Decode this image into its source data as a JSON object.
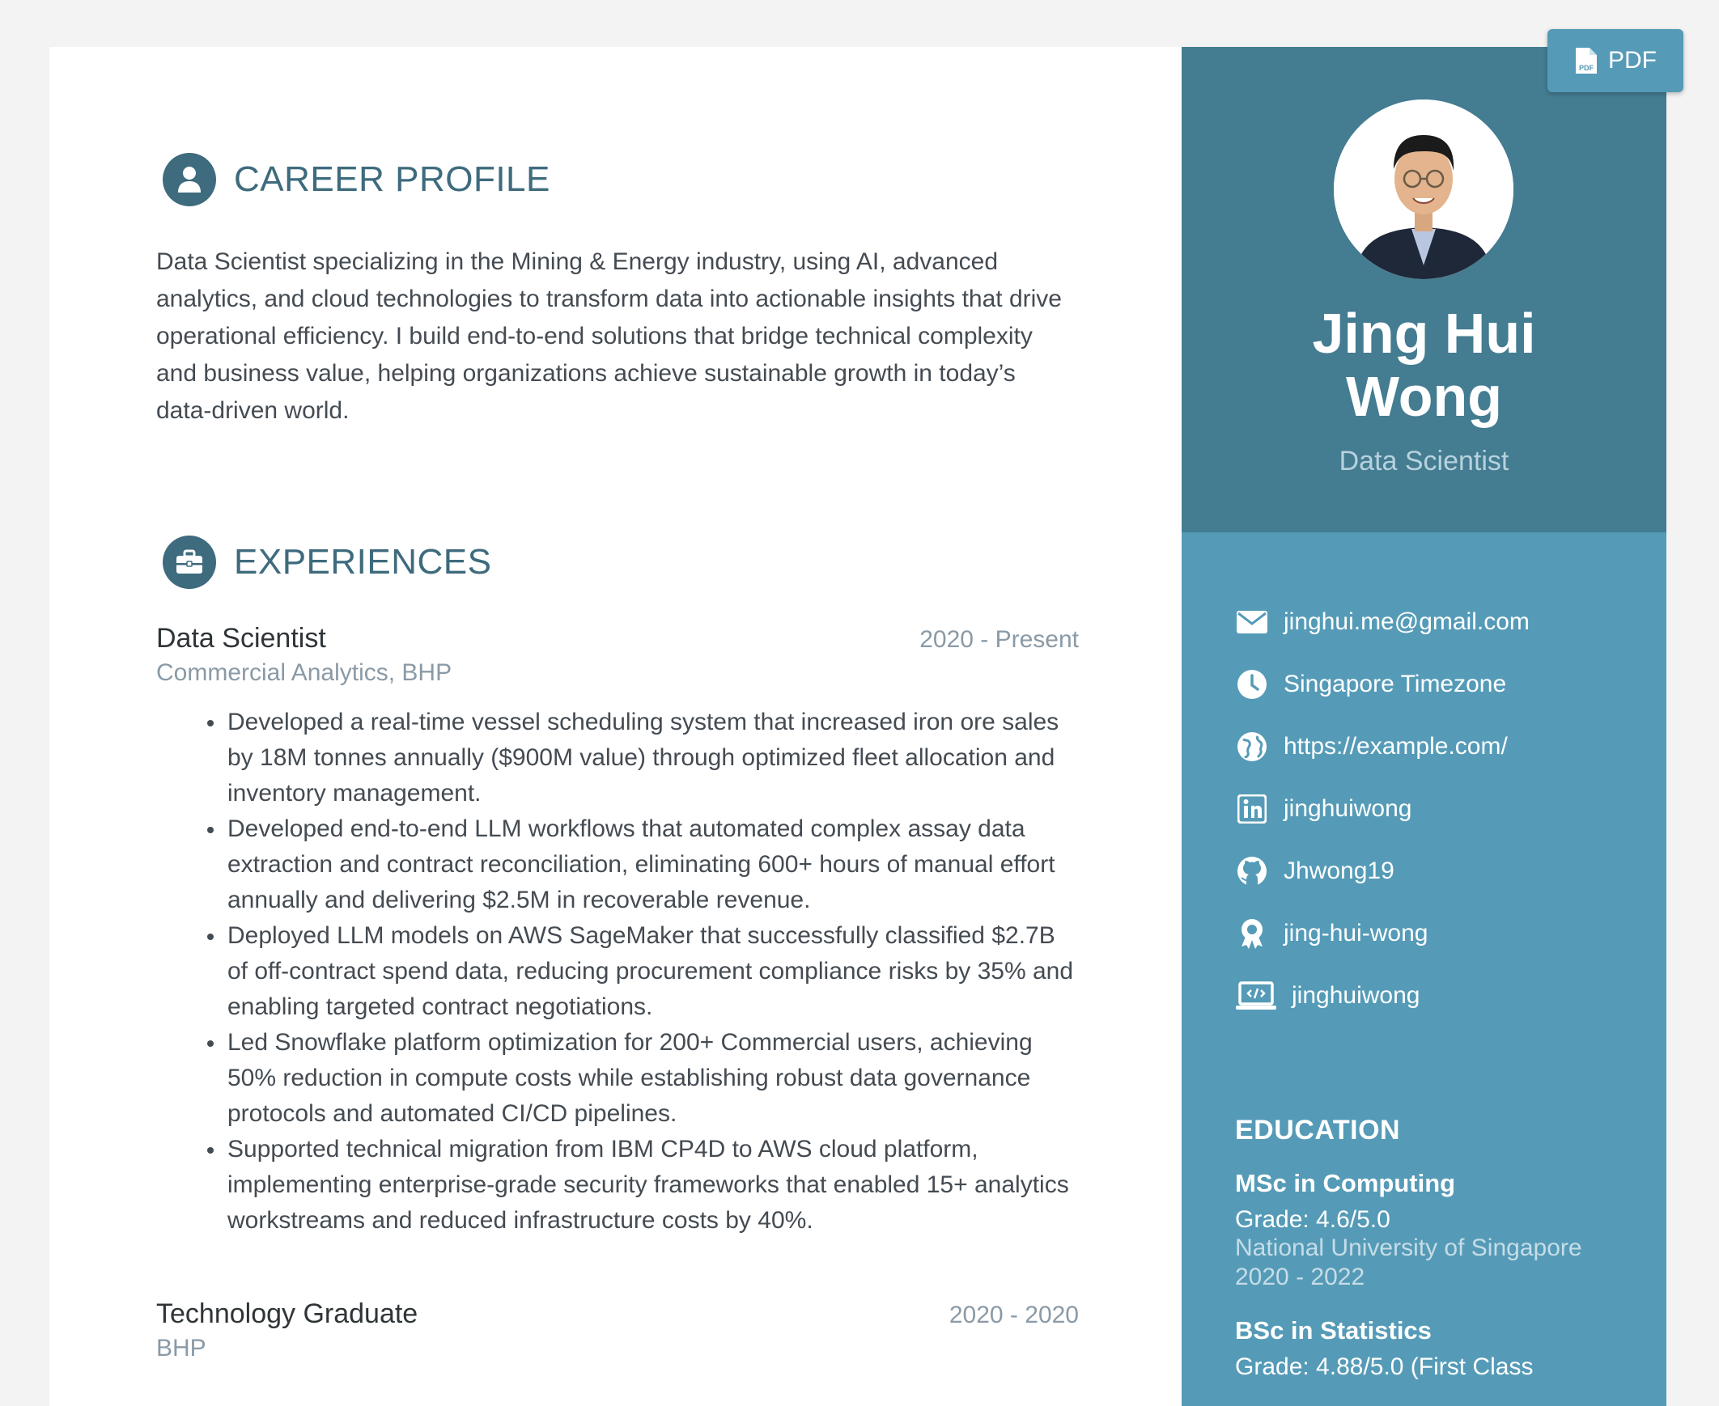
{
  "career_profile": {
    "title": "CAREER PROFILE",
    "icon": "user-icon",
    "summary": "Data Scientist specializing in the Mining & Energy industry, using AI, advanced analytics, and cloud technologies to transform data into actionable insights that drive operational efficiency. I build end-to-end solutions that bridge technical complexity and business value, helping organizations achieve sustainable growth in today’s data-driven world."
  },
  "experiences": {
    "title": "EXPERIENCES",
    "icon": "briefcase-icon",
    "jobs": [
      {
        "title": "Data Scientist",
        "time": "2020 - Present",
        "company": "Commercial Analytics, BHP",
        "bullets": [
          "Developed a real-time vessel scheduling system that increased iron ore sales by 18M tonnes annually ($900M value) through optimized fleet allocation and inventory management.",
          "Developed end-to-end LLM workflows that automated complex assay data extraction and contract reconciliation, eliminating 600+ hours of manual effort annually and delivering $2.5M in recoverable revenue.",
          "Deployed LLM models on AWS SageMaker that successfully classified $2.7B of off-contract spend data, reducing procurement compliance risks by 35% and enabling targeted contract negotiations.",
          "Led Snowflake platform optimization for 200+ Commercial users, achieving 50% reduction in compute costs while establishing robust data governance protocols and automated CI/CD pipelines.",
          "Supported technical migration from IBM CP4D to AWS cloud platform, implementing enterprise-grade security frameworks that enabled 15+ analytics workstreams and reduced infrastructure costs by 40%."
        ]
      },
      {
        "title": "Technology Graduate",
        "time": "2020 - 2020",
        "company": "BHP"
      }
    ]
  },
  "sidebar": {
    "name_line1": "Jing Hui",
    "name_line2": "Wong",
    "tagline": "Data Scientist",
    "contacts": [
      {
        "icon": "envelope-icon",
        "text": "jinghui.me@gmail.com"
      },
      {
        "icon": "clock-icon",
        "text": "Singapore Timezone"
      },
      {
        "icon": "globe-icon",
        "text": "https://example.com/"
      },
      {
        "icon": "linkedin-icon",
        "text": "jinghuiwong"
      },
      {
        "icon": "github-icon",
        "text": "Jhwong19"
      },
      {
        "icon": "award-icon",
        "text": "jing-hui-wong"
      },
      {
        "icon": "laptop-code-icon",
        "text": "jinghuiwong"
      }
    ],
    "education": {
      "title": "EDUCATION",
      "degrees": [
        {
          "degree": "MSc in Computing",
          "grade": "Grade: 4.6/5.0",
          "school": "National University of Singapore",
          "time": "2020 - 2022"
        },
        {
          "degree": "BSc in Statistics",
          "grade": "Grade: 4.88/5.0 (First Class"
        }
      ]
    }
  },
  "pdf_button": {
    "label": "PDF",
    "icon": "file-pdf-icon"
  },
  "colors": {
    "accent_dark": "#447c91",
    "accent": "#559bb7",
    "heading": "#3e6b7d"
  }
}
